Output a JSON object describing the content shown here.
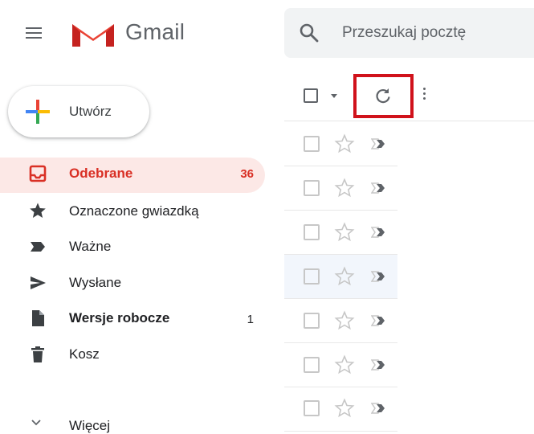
{
  "header": {
    "brand": "Gmail",
    "search_placeholder": "Przeszukaj pocztę"
  },
  "compose": {
    "label": "Utwórz"
  },
  "sidebar": {
    "items": [
      {
        "label": "Odebrane",
        "count": "36",
        "icon": "inbox-icon",
        "active": true
      },
      {
        "label": "Oznaczone gwiazdką",
        "count": "",
        "icon": "star-icon"
      },
      {
        "label": "Ważne",
        "count": "",
        "icon": "important-icon"
      },
      {
        "label": "Wysłane",
        "count": "",
        "icon": "send-icon"
      },
      {
        "label": "Wersje robocze",
        "count": "1",
        "icon": "draft-icon"
      },
      {
        "label": "Kosz",
        "count": "",
        "icon": "trash-icon"
      }
    ],
    "more_label": "Więcej"
  },
  "toolbar": {
    "select_icon": "checkbox-icon",
    "refresh_icon": "refresh-icon",
    "more_icon": "more-vert-icon",
    "highlight_color": "#d0121b"
  },
  "colors": {
    "accent_red": "#d93025",
    "active_bg": "#fce8e6"
  }
}
